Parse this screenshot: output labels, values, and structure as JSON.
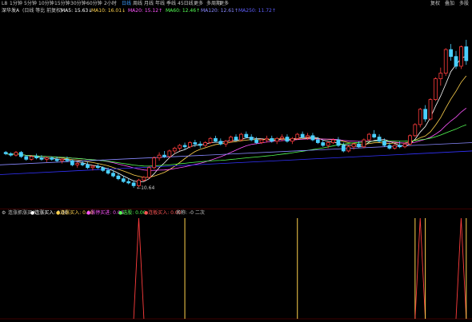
{
  "toolbar": {
    "tabs": [
      {
        "label": "L8",
        "active": false
      },
      {
        "label": "1分钟",
        "active": false
      },
      {
        "label": "5分钟",
        "active": false
      },
      {
        "label": "10分钟",
        "active": false
      },
      {
        "label": "15分钟",
        "active": false
      },
      {
        "label": "30分钟",
        "active": false
      },
      {
        "label": "60分钟",
        "active": false
      },
      {
        "label": "2小时",
        "active": false
      },
      {
        "label": "日线",
        "active": true
      },
      {
        "label": "周线",
        "active": false
      },
      {
        "label": "月线",
        "active": false
      },
      {
        "label": "年线",
        "active": false
      },
      {
        "label": "季线",
        "active": false
      },
      {
        "label": "45日线",
        "active": false
      },
      {
        "label": "更多",
        "active": false
      },
      {
        "label": "多周期",
        "active": false
      },
      {
        "label": "更多",
        "active": false
      }
    ],
    "right_buttons": [
      "复权",
      "叠加",
      "多股"
    ]
  },
  "info": {
    "stock": "深华发A",
    "indicator": "(日线 等比 前复权)",
    "ma5": "MA5: 15.63↓",
    "ma10": "MA10: 16.01↓",
    "ma20": "MA20: 15.12↑",
    "ma60": "MA60: 12.46↑",
    "ma120": "MA120: 12.61↑",
    "ma250": "MA250: 11.72↑"
  },
  "main_chart": {
    "low_label": "10.64"
  },
  "indicator_bar": {
    "name": "连涨抓涨买入",
    "items": [
      {
        "label": "●连涨买入: 0.00",
        "color": "#ffffff"
      },
      {
        "label": "●连涨买入: 0.00",
        "color": "#ffd24d"
      },
      {
        "label": "●涨停买进: 0.00",
        "color": "#ff55ff"
      },
      {
        "label": "●选股: 0.00",
        "color": "#55ff55"
      },
      {
        "label": "●连板买入: 0.00",
        "color": "#ff5555"
      },
      {
        "label": "名称: -0 二次",
        "color": "#c8c8c8"
      }
    ]
  },
  "colors": {
    "up": "#ff3d3d",
    "down": "#4ad0ff",
    "ma5": "#ffffff",
    "ma10": "#ffd24d",
    "ma20": "#ff55ff",
    "ma60": "#55ff55",
    "ma120": "#8888ff",
    "ma250": "#3333ff"
  },
  "chart_data": {
    "type": "candlestick",
    "candles": [
      [
        13.2,
        13.3,
        13.0,
        13.1
      ],
      [
        13.1,
        13.2,
        12.9,
        13.0
      ],
      [
        13.0,
        13.3,
        12.9,
        13.2
      ],
      [
        13.2,
        13.3,
        12.8,
        12.9
      ],
      [
        12.9,
        13.0,
        12.6,
        12.7
      ],
      [
        12.7,
        13.0,
        12.6,
        12.9
      ],
      [
        12.9,
        13.1,
        12.7,
        12.8
      ],
      [
        12.8,
        13.0,
        12.6,
        12.7
      ],
      [
        12.7,
        12.9,
        12.5,
        12.8
      ],
      [
        12.8,
        12.9,
        12.6,
        12.7
      ],
      [
        12.7,
        12.9,
        12.5,
        12.6
      ],
      [
        12.6,
        12.8,
        12.4,
        12.7
      ],
      [
        12.7,
        12.9,
        12.5,
        12.6
      ],
      [
        12.6,
        12.7,
        12.2,
        12.3
      ],
      [
        12.3,
        12.5,
        12.1,
        12.4
      ],
      [
        12.4,
        12.6,
        12.2,
        12.3
      ],
      [
        12.3,
        12.5,
        12.0,
        12.1
      ],
      [
        12.1,
        12.3,
        11.9,
        12.2
      ],
      [
        12.2,
        12.4,
        12.0,
        12.1
      ],
      [
        12.1,
        12.2,
        11.8,
        11.9
      ],
      [
        11.9,
        12.1,
        11.6,
        11.7
      ],
      [
        11.7,
        11.9,
        11.4,
        11.5
      ],
      [
        11.5,
        11.7,
        11.2,
        11.3
      ],
      [
        11.3,
        11.5,
        11.0,
        11.1
      ],
      [
        11.1,
        11.3,
        10.9,
        11.0
      ],
      [
        11.0,
        11.2,
        10.64,
        10.8
      ],
      [
        10.8,
        11.3,
        10.7,
        11.2
      ],
      [
        11.2,
        11.5,
        11.1,
        11.4
      ],
      [
        11.4,
        12.2,
        11.3,
        12.1
      ],
      [
        12.1,
        12.9,
        12.0,
        12.8
      ],
      [
        12.8,
        13.2,
        12.6,
        13.0
      ],
      [
        13.0,
        13.3,
        12.8,
        12.9
      ],
      [
        12.9,
        13.4,
        12.8,
        13.3
      ],
      [
        13.3,
        13.6,
        13.1,
        13.5
      ],
      [
        13.5,
        13.8,
        13.3,
        13.7
      ],
      [
        13.7,
        13.9,
        13.4,
        13.6
      ],
      [
        13.6,
        14.0,
        13.5,
        13.9
      ],
      [
        13.9,
        14.1,
        13.6,
        13.8
      ],
      [
        13.8,
        14.0,
        13.5,
        13.7
      ],
      [
        13.7,
        14.0,
        13.6,
        13.9
      ],
      [
        13.9,
        14.3,
        13.8,
        14.2
      ],
      [
        14.2,
        14.4,
        13.9,
        14.0
      ],
      [
        14.0,
        14.2,
        13.7,
        13.8
      ],
      [
        13.8,
        14.1,
        13.6,
        14.0
      ],
      [
        14.0,
        14.4,
        13.9,
        14.3
      ],
      [
        14.3,
        14.5,
        14.0,
        14.1
      ],
      [
        14.1,
        14.6,
        14.0,
        14.5
      ],
      [
        14.5,
        14.7,
        14.2,
        14.3
      ],
      [
        14.3,
        14.5,
        14.0,
        14.1
      ],
      [
        14.1,
        14.3,
        13.8,
        13.9
      ],
      [
        13.9,
        14.2,
        13.8,
        14.1
      ],
      [
        14.1,
        14.4,
        13.9,
        14.2
      ],
      [
        14.2,
        14.4,
        13.9,
        14.0
      ],
      [
        14.0,
        14.3,
        13.8,
        14.2
      ],
      [
        14.2,
        14.5,
        14.0,
        14.3
      ],
      [
        14.3,
        14.5,
        13.9,
        14.0
      ],
      [
        14.0,
        14.3,
        13.8,
        14.2
      ],
      [
        14.2,
        14.6,
        14.1,
        14.5
      ],
      [
        14.5,
        14.7,
        14.2,
        14.3
      ],
      [
        14.3,
        14.6,
        14.1,
        14.4
      ],
      [
        14.4,
        14.6,
        14.0,
        14.1
      ],
      [
        14.1,
        14.3,
        13.8,
        13.9
      ],
      [
        13.9,
        14.1,
        13.6,
        13.7
      ],
      [
        13.7,
        14.0,
        13.5,
        13.9
      ],
      [
        13.9,
        14.2,
        13.8,
        14.1
      ],
      [
        14.1,
        14.3,
        13.6,
        13.7
      ],
      [
        13.7,
        13.9,
        13.2,
        13.3
      ],
      [
        13.3,
        13.7,
        13.2,
        13.6
      ],
      [
        13.6,
        13.9,
        13.4,
        13.8
      ],
      [
        13.8,
        14.0,
        13.5,
        13.6
      ],
      [
        13.6,
        14.2,
        13.5,
        14.1
      ],
      [
        14.1,
        14.6,
        14.0,
        14.5
      ],
      [
        14.5,
        14.8,
        14.2,
        14.3
      ],
      [
        14.3,
        14.5,
        13.9,
        14.0
      ],
      [
        14.0,
        14.2,
        13.6,
        13.7
      ],
      [
        13.7,
        13.9,
        13.4,
        13.5
      ],
      [
        13.5,
        13.8,
        13.4,
        13.7
      ],
      [
        13.7,
        14.0,
        13.5,
        13.6
      ],
      [
        13.6,
        13.9,
        13.5,
        13.8
      ],
      [
        13.8,
        14.5,
        13.7,
        14.4
      ],
      [
        14.4,
        15.3,
        14.3,
        15.2
      ],
      [
        15.2,
        16.4,
        15.0,
        16.3
      ],
      [
        16.3,
        16.6,
        15.4,
        15.6
      ],
      [
        15.6,
        17.1,
        15.5,
        17.0
      ],
      [
        17.0,
        18.6,
        16.9,
        18.5
      ],
      [
        18.5,
        19.3,
        18.0,
        18.9
      ],
      [
        18.9,
        20.7,
        18.7,
        20.6
      ],
      [
        20.6,
        21.0,
        19.8,
        20.1
      ],
      [
        20.1,
        20.5,
        19.2,
        19.4
      ],
      [
        19.4,
        20.9,
        19.2,
        20.8
      ],
      [
        20.8,
        21.3,
        19.5,
        19.8
      ]
    ],
    "signals": [
      {
        "index": 26,
        "value": 1,
        "color": "#ff3d3d"
      },
      {
        "index": 35,
        "value": 1,
        "color": "#ffd24d"
      },
      {
        "index": 57,
        "value": 1,
        "color": "#ffd24d"
      },
      {
        "index": 80,
        "value": 1,
        "color": "#ffd24d"
      },
      {
        "index": 81,
        "value": 1,
        "color": "#ff3d3d"
      },
      {
        "index": 82,
        "value": 1,
        "color": "#ffd24d"
      },
      {
        "index": 89,
        "value": 1,
        "color": "#ff3d3d"
      },
      {
        "index": 90,
        "value": 1,
        "color": "#ffd24d"
      }
    ],
    "ylim": [
      9.5,
      22.5
    ]
  }
}
